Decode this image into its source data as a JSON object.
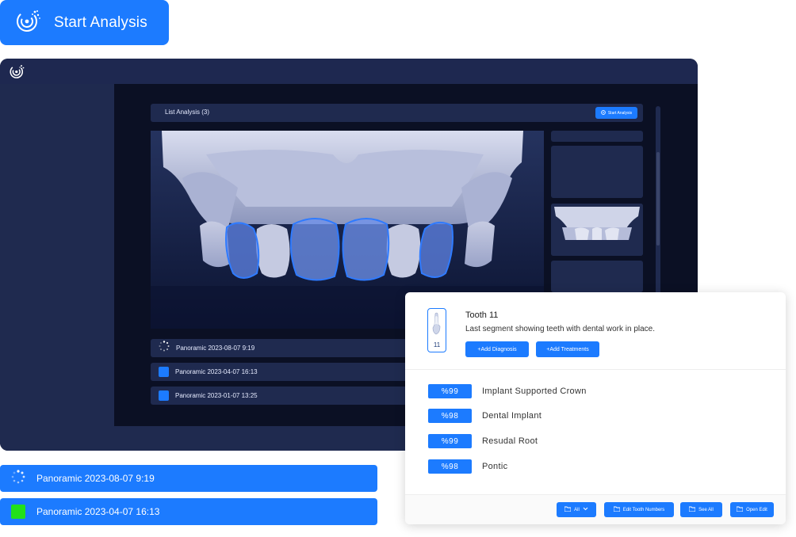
{
  "hero": {
    "label": "Start Analysis",
    "icon": "analysis-logo-icon"
  },
  "app": {
    "logo_icon": "analysis-logo-icon",
    "list_title": "List Analysis (3)",
    "start_button": "Start Analysis",
    "rows": [
      {
        "label": "Panoramic 2023-08-07 9:19",
        "status": "loading"
      },
      {
        "label": "Panoramic 2023-04-07 16:13",
        "status": "done"
      },
      {
        "label": "Panoramic 2023-01-07 13:25",
        "status": "done"
      }
    ]
  },
  "bottom_rows": [
    {
      "label": "Panoramic 2023-08-07 9:19",
      "status": "loading"
    },
    {
      "label": "Panoramic 2023-04-07 16:13",
      "status": "complete"
    }
  ],
  "detail": {
    "tooth_number": "11",
    "title": "Tooth 11",
    "description": "Last segment showing teeth with dental work in place.",
    "add_diagnosis": "+Add Diagnosis",
    "add_treatments": "+Add Treatments",
    "predictions": [
      {
        "score": "%99",
        "label": "Implant Supported Crown"
      },
      {
        "score": "%98",
        "label": "Dental Implant"
      },
      {
        "score": "%99",
        "label": "Resudal Root"
      },
      {
        "score": "%98",
        "label": "Pontic"
      }
    ],
    "footer": {
      "filter": "All",
      "edit_tooth_numbers": "Edit Tooth Numbers",
      "see_all": "See All",
      "open_edit": "Open Edit"
    }
  },
  "colors": {
    "accent": "#1c7bff",
    "window_bg": "#0b1024",
    "panel": "#1f2a4f",
    "complete": "#22e01a"
  }
}
